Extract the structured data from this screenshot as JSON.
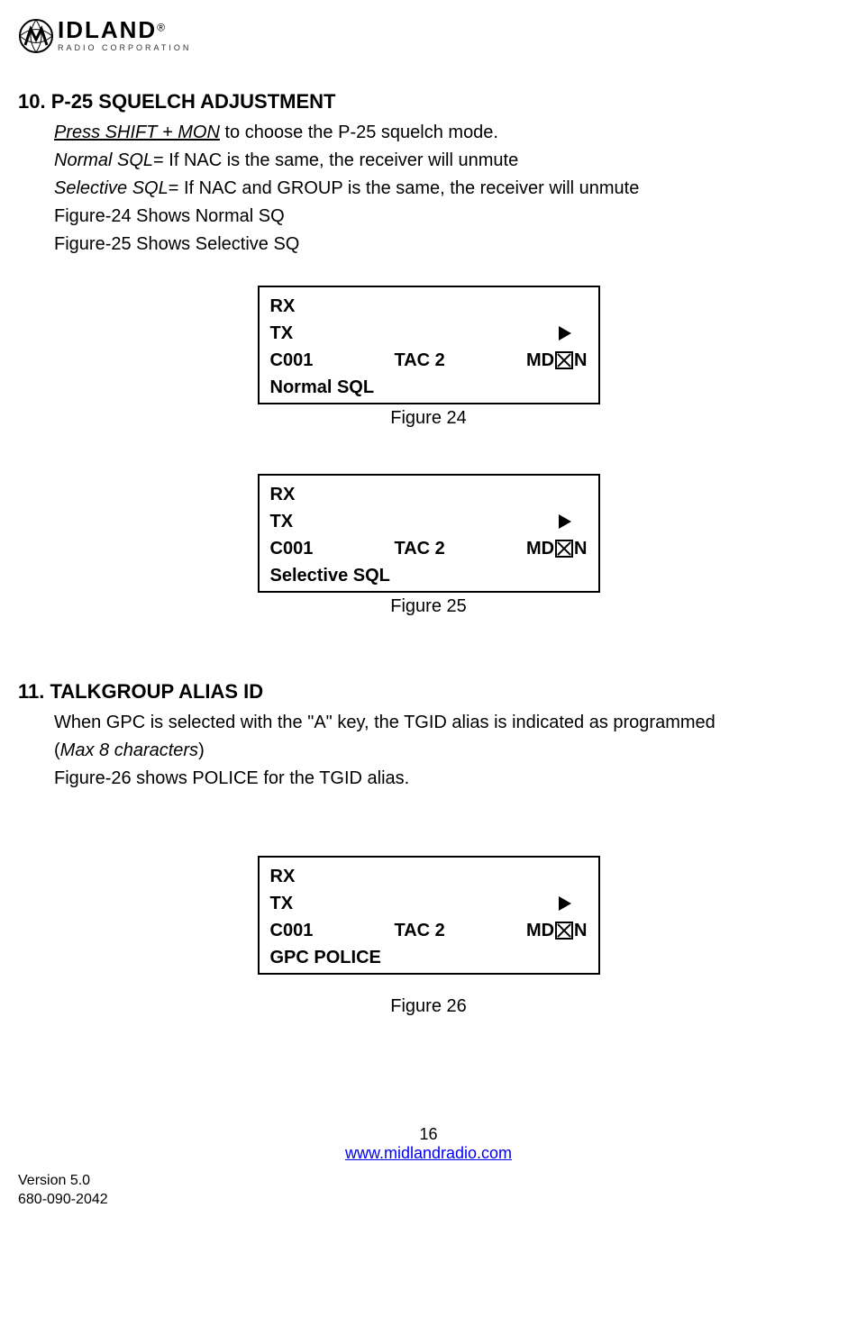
{
  "logo": {
    "name_main": "IDLAND",
    "name_sub": "RADIO CORPORATION",
    "reg": "®"
  },
  "section10": {
    "heading": "10. P-25 SQUELCH ADJUSTMENT",
    "line1_u": "Press SHIFT + MON",
    "line1_rest": " to choose the P-25 squelch mode.",
    "line2_i": "Normal SQL",
    "line2_rest": "= If NAC is the same, the receiver will unmute",
    "line3_i": "Selective SQL",
    "line3_rest": "= If NAC and GROUP is the same, the receiver will unmute",
    "line4": "Figure-24 Shows Normal SQ",
    "line5": "Figure-25 Shows Selective SQ"
  },
  "figure24": {
    "rx": "RX",
    "tx": "TX",
    "c": "C001",
    "tac": "TAC 2",
    "md_pre": "MD",
    "md_post": "N",
    "bottom": "Normal SQL",
    "caption": "Figure 24"
  },
  "figure25": {
    "rx": "RX",
    "tx": "TX",
    "c": "C001",
    "tac": "TAC 2",
    "md_pre": "MD",
    "md_post": "N",
    "bottom": "Selective SQL",
    "caption": "Figure 25"
  },
  "section11": {
    "heading": "11. TALKGROUP ALIAS ID",
    "line1": "When GPC is selected with the \"A\" key, the TGID alias is indicated as programmed",
    "line2_pre": " (",
    "line2_i": "Max 8 characters",
    "line2_post": ")",
    "line3": "Figure-26 shows POLICE for the TGID alias."
  },
  "figure26": {
    "rx": "RX",
    "tx": "TX",
    "c": "C001",
    "tac": "TAC 2",
    "md_pre": "MD",
    "md_post": "N",
    "bottom": "GPC POLICE",
    "caption": "Figure 26"
  },
  "footer": {
    "page": "16",
    "url": "www.midlandradio.com",
    "version": "Version 5.0",
    "docnum": "680-090-2042"
  }
}
